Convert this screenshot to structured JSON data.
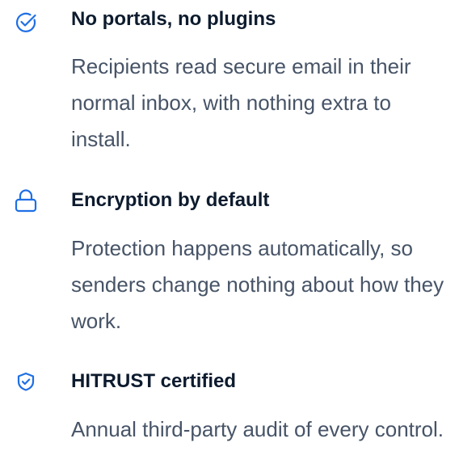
{
  "colors": {
    "accent": "#1f6fe5",
    "title": "#0d1b2e",
    "body": "#475467",
    "background": "#ffffff"
  },
  "features": [
    {
      "icon": "check-circle-icon",
      "title": "No portals, no plugins",
      "description": "Recipients read secure email in their normal inbox, with nothing extra to install."
    },
    {
      "icon": "lock-icon",
      "title": "Encryption by default",
      "description": "Protection happens automatically, so senders change nothing about how they work."
    },
    {
      "icon": "shield-check-icon",
      "title": "HITRUST certified",
      "description": "Annual third-party audit of every control."
    }
  ]
}
